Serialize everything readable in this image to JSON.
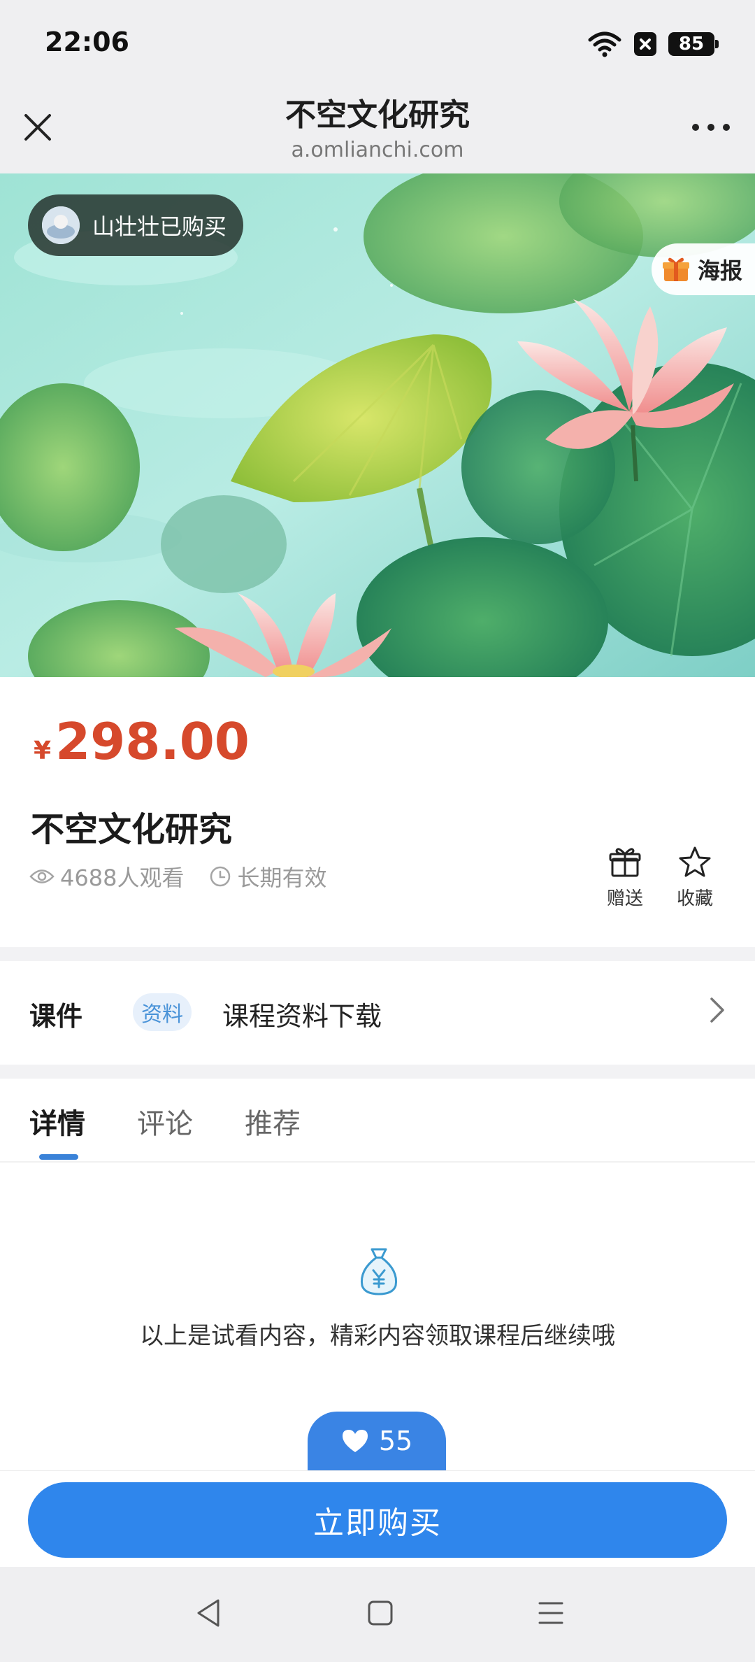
{
  "status_bar": {
    "time": "22:06",
    "battery": "85"
  },
  "title_bar": {
    "title": "不空文化研究",
    "url": "a.omlianchi.com"
  },
  "hero": {
    "buyer_text": "山壮壮已购买",
    "poster_label": "海报"
  },
  "product": {
    "currency_symbol": "¥",
    "price": "298.00",
    "title": "不空文化研究",
    "views": "4688人观看",
    "validity": "长期有效",
    "gift_label": "赠送",
    "favorite_label": "收藏"
  },
  "courseware": {
    "label": "课件",
    "tag": "资料",
    "text": "课程资料下载"
  },
  "tabs": [
    {
      "label": "详情"
    },
    {
      "label": "评论"
    },
    {
      "label": "推荐"
    }
  ],
  "detail": {
    "notice": "以上是试看内容，精彩内容领取课程后继续哦",
    "likes": "55"
  },
  "buy": {
    "label": "立即购买"
  },
  "colors": {
    "price": "#d6492c",
    "accent_blue": "#2f86ec",
    "tab_indicator": "#3a82d8"
  },
  "icons": [
    "wifi-icon",
    "notification-x-icon",
    "close-icon",
    "more-icon",
    "gift-icon",
    "eye-icon",
    "clock-icon",
    "star-icon",
    "chevron-right-icon",
    "money-bag-icon",
    "heart-icon",
    "back-icon",
    "home-icon",
    "menu-icon"
  ]
}
